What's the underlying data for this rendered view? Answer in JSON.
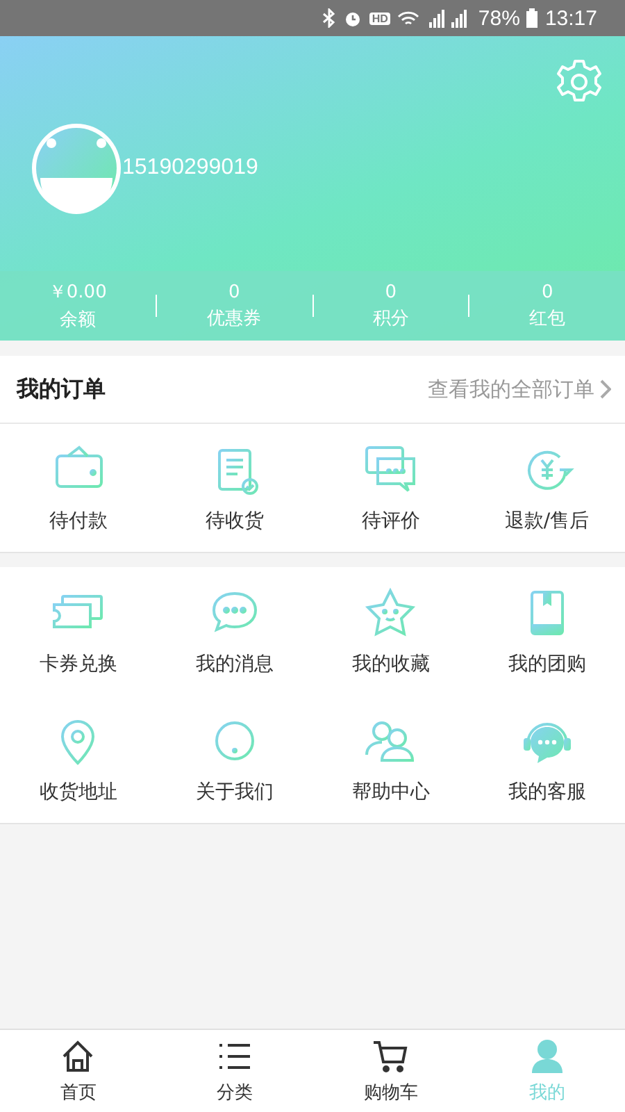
{
  "status_bar": {
    "hd": "HD",
    "battery": "78%",
    "time": "13:17"
  },
  "profile": {
    "phone": "15190299019"
  },
  "stats": [
    {
      "value": "￥0.00",
      "label": "余额"
    },
    {
      "value": "0",
      "label": "优惠券"
    },
    {
      "value": "0",
      "label": "积分"
    },
    {
      "value": "0",
      "label": "红包"
    }
  ],
  "orders": {
    "title": "我的订单",
    "link": "查看我的全部订单",
    "items": [
      {
        "kind": "wallet",
        "label": "待付款"
      },
      {
        "kind": "receipt",
        "label": "待收货"
      },
      {
        "kind": "chat",
        "label": "待评价"
      },
      {
        "kind": "refund",
        "label": "退款/售后"
      }
    ]
  },
  "services": [
    {
      "kind": "ticket",
      "label": "卡券兑换"
    },
    {
      "kind": "message",
      "label": "我的消息"
    },
    {
      "kind": "star",
      "label": "我的收藏"
    },
    {
      "kind": "book",
      "label": "我的团购"
    },
    {
      "kind": "pin",
      "label": "收货地址"
    },
    {
      "kind": "info",
      "label": "关于我们"
    },
    {
      "kind": "people",
      "label": "帮助中心"
    },
    {
      "kind": "headset",
      "label": "我的客服"
    }
  ],
  "nav": [
    {
      "kind": "home",
      "label": "首页",
      "selected": false
    },
    {
      "kind": "list",
      "label": "分类",
      "selected": false
    },
    {
      "kind": "cart",
      "label": "购物车",
      "selected": false
    },
    {
      "kind": "person",
      "label": "我的",
      "selected": true
    }
  ]
}
